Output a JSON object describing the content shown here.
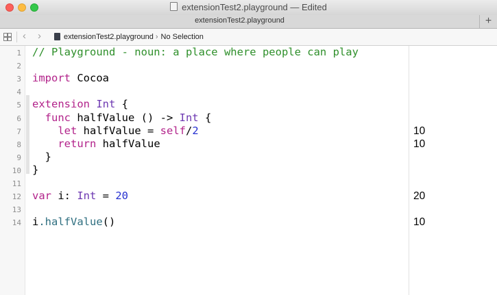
{
  "window": {
    "title": "extensionTest2.playground — Edited"
  },
  "tabbar": {
    "tab_label": "extensionTest2.playground",
    "add_symbol": "+"
  },
  "jumpbar": {
    "back_symbol": "‹",
    "forward_symbol": "›",
    "crumb_file": "extensionTest2.playground",
    "crumb_chevron": "›",
    "crumb_selection": "No Selection"
  },
  "editor": {
    "lines": [
      {
        "num": "1",
        "tokens": [
          {
            "t": "// Playground - noun: a place where people can play",
            "c": "comment"
          }
        ]
      },
      {
        "num": "2",
        "tokens": []
      },
      {
        "num": "3",
        "tokens": [
          {
            "t": "import",
            "c": "kw"
          },
          {
            "t": " Cocoa",
            "c": "plain"
          }
        ]
      },
      {
        "num": "4",
        "tokens": []
      },
      {
        "num": "5",
        "tokens": [
          {
            "t": "extension",
            "c": "kw"
          },
          {
            "t": " ",
            "c": "plain"
          },
          {
            "t": "Int",
            "c": "type"
          },
          {
            "t": " {",
            "c": "plain"
          }
        ]
      },
      {
        "num": "6",
        "tokens": [
          {
            "t": "  ",
            "c": "plain"
          },
          {
            "t": "func",
            "c": "kw"
          },
          {
            "t": " halfValue () -> ",
            "c": "plain"
          },
          {
            "t": "Int",
            "c": "type"
          },
          {
            "t": " {",
            "c": "plain"
          }
        ]
      },
      {
        "num": "7",
        "tokens": [
          {
            "t": "    ",
            "c": "plain"
          },
          {
            "t": "let",
            "c": "kw"
          },
          {
            "t": " halfValue = ",
            "c": "plain"
          },
          {
            "t": "self",
            "c": "kw"
          },
          {
            "t": "/",
            "c": "plain"
          },
          {
            "t": "2",
            "c": "num"
          }
        ],
        "result": "10"
      },
      {
        "num": "8",
        "tokens": [
          {
            "t": "    ",
            "c": "plain"
          },
          {
            "t": "return",
            "c": "kw"
          },
          {
            "t": " halfValue",
            "c": "plain"
          }
        ],
        "result": "10"
      },
      {
        "num": "9",
        "tokens": [
          {
            "t": "  }",
            "c": "plain"
          }
        ]
      },
      {
        "num": "10",
        "tokens": [
          {
            "t": "}",
            "c": "plain"
          }
        ]
      },
      {
        "num": "11",
        "tokens": []
      },
      {
        "num": "12",
        "tokens": [
          {
            "t": "var",
            "c": "kw"
          },
          {
            "t": " i: ",
            "c": "plain"
          },
          {
            "t": "Int",
            "c": "type"
          },
          {
            "t": " = ",
            "c": "plain"
          },
          {
            "t": "20",
            "c": "num"
          }
        ],
        "result": "20"
      },
      {
        "num": "13",
        "tokens": []
      },
      {
        "num": "14",
        "tokens": [
          {
            "t": "i",
            "c": "plain"
          },
          {
            "t": ".halfValue",
            "c": "fn"
          },
          {
            "t": "()",
            "c": "plain"
          }
        ],
        "result": "10"
      }
    ]
  },
  "colors": {
    "comment": "#2e8f2a",
    "keyword": "#b2228a",
    "type": "#6d38b1",
    "number": "#2530d0",
    "function": "#2f6f80"
  }
}
